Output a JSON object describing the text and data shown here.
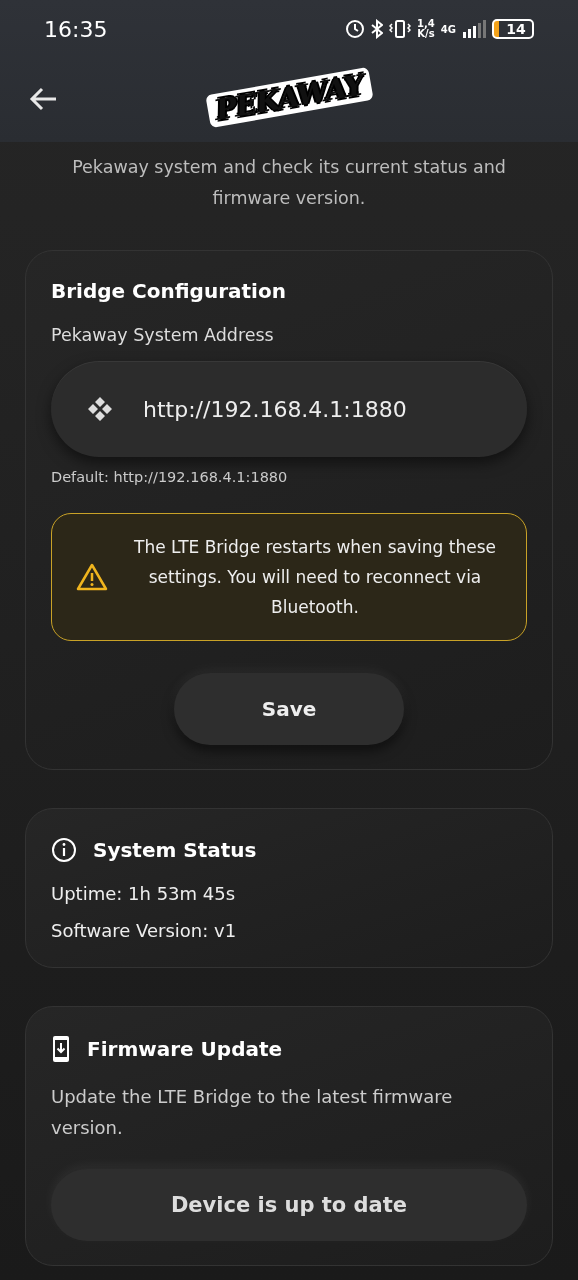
{
  "status_bar": {
    "time": "16:35",
    "speed_value": "1,4",
    "speed_unit": "K/s",
    "network": "4G",
    "battery": "14"
  },
  "header": {
    "logo": "PEKAWAY"
  },
  "intro": "Pekaway system and check its current status and firmware version.",
  "bridge_config": {
    "title": "Bridge Configuration",
    "field_label": "Pekaway System Address",
    "field_value": "http://192.168.4.1:1880",
    "hint": "Default: http://192.168.4.1:1880",
    "warning": "The LTE Bridge restarts when saving these settings. You will need to reconnect via Bluetooth.",
    "save_button": "Save"
  },
  "system_status": {
    "title": "System Status",
    "lines": [
      "Uptime: 1h 53m 45s",
      "Software Version: v1"
    ]
  },
  "firmware_update": {
    "title": "Firmware Update",
    "description": "Update the LTE Bridge to the latest firmware version.",
    "button": "Device is up to date"
  }
}
